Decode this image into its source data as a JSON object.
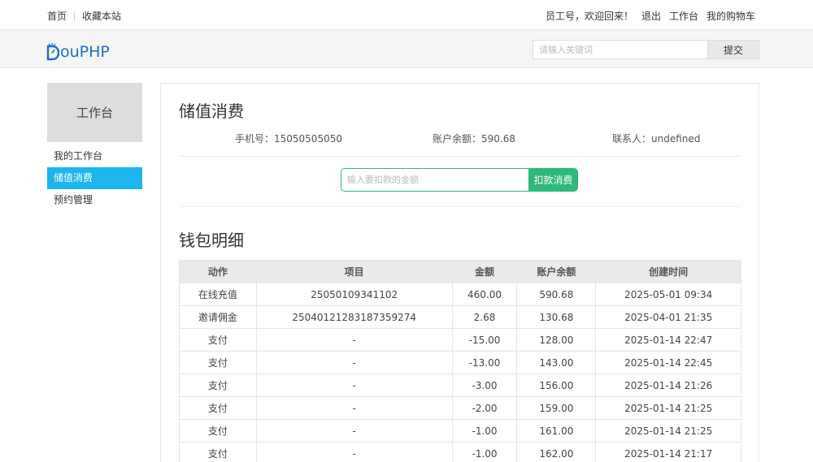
{
  "topbar": {
    "home": "首页",
    "favorite": "收藏本站",
    "greeting": "员工号，欢迎回来！",
    "logout": "退出",
    "workbench": "工作台",
    "cart": "我的购物车"
  },
  "header": {
    "logo": "ouPHP",
    "search_placeholder": "请输入关键词",
    "search_button": "提交"
  },
  "sidebar": {
    "title": "工作台",
    "items": [
      {
        "label": "我的工作台"
      },
      {
        "label": "储值消费"
      },
      {
        "label": "预约管理"
      }
    ]
  },
  "main": {
    "title": "储值消费",
    "phone": "手机号：15050505050",
    "balance": "账户余额：590.68",
    "contact": "联系人：undefined",
    "deduct_placeholder": "输入要扣款的金额",
    "deduct_button": "扣款消费",
    "wallet_title": "钱包明细",
    "table": {
      "headers": [
        "动作",
        "项目",
        "金额",
        "账户余额",
        "创建时间"
      ],
      "rows": [
        [
          "在线充值",
          "25050109341102",
          "460.00",
          "590.68",
          "2025-05-01 09:34"
        ],
        [
          "邀请佣金",
          "25040121283187359274",
          "2.68",
          "130.68",
          "2025-04-01 21:35"
        ],
        [
          "支付",
          "-",
          "-15.00",
          "128.00",
          "2025-01-14 22:47"
        ],
        [
          "支付",
          "-",
          "-13.00",
          "143.00",
          "2025-01-14 22:45"
        ],
        [
          "支付",
          "-",
          "-3.00",
          "156.00",
          "2025-01-14 21:26"
        ],
        [
          "支付",
          "-",
          "-2.00",
          "159.00",
          "2025-01-14 21:25"
        ],
        [
          "支付",
          "-",
          "-1.00",
          "161.00",
          "2025-01-14 21:25"
        ],
        [
          "支付",
          "-",
          "-1.00",
          "162.00",
          "2025-01-14 21:17"
        ]
      ]
    }
  },
  "colors": {
    "active_menu": "#1cb5f0",
    "deduct_button": "#2eb87a",
    "logo": "#1a6fc4"
  }
}
